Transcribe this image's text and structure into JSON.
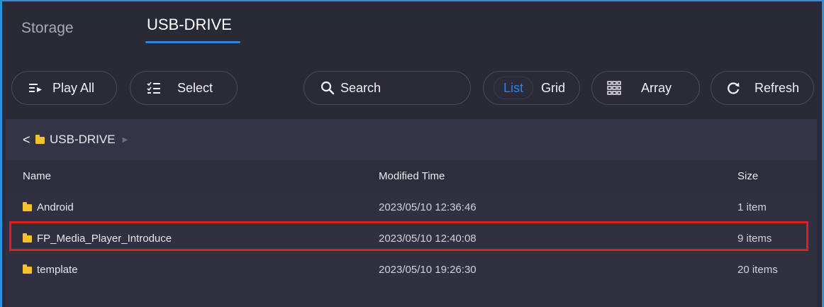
{
  "tabs": [
    {
      "label": "Storage",
      "active": false
    },
    {
      "label": "USB-DRIVE",
      "active": true
    }
  ],
  "toolbar": {
    "play_all": "Play All",
    "select": "Select",
    "search": "Search",
    "view_list": "List",
    "view_grid": "Grid",
    "array": "Array",
    "refresh": "Refresh"
  },
  "breadcrumb": {
    "back": "<",
    "path": "USB-DRIVE",
    "arrow": "▶"
  },
  "table": {
    "columns": [
      "Name",
      "Modified Time",
      "Size"
    ],
    "rows": [
      {
        "name": "Android",
        "modified": "2023/05/10 12:36:46",
        "size": "1 item"
      },
      {
        "name": "FP_Media_Player_Introduce",
        "modified": "2023/05/10 12:40:08",
        "size": "9 items"
      },
      {
        "name": "template",
        "modified": "2023/05/10 19:26:30",
        "size": "20 items"
      }
    ]
  },
  "colors": {
    "accent": "#2b84e6",
    "background": "#2a2a36",
    "highlight": "#e31c23",
    "folder": "#f6c12e"
  }
}
